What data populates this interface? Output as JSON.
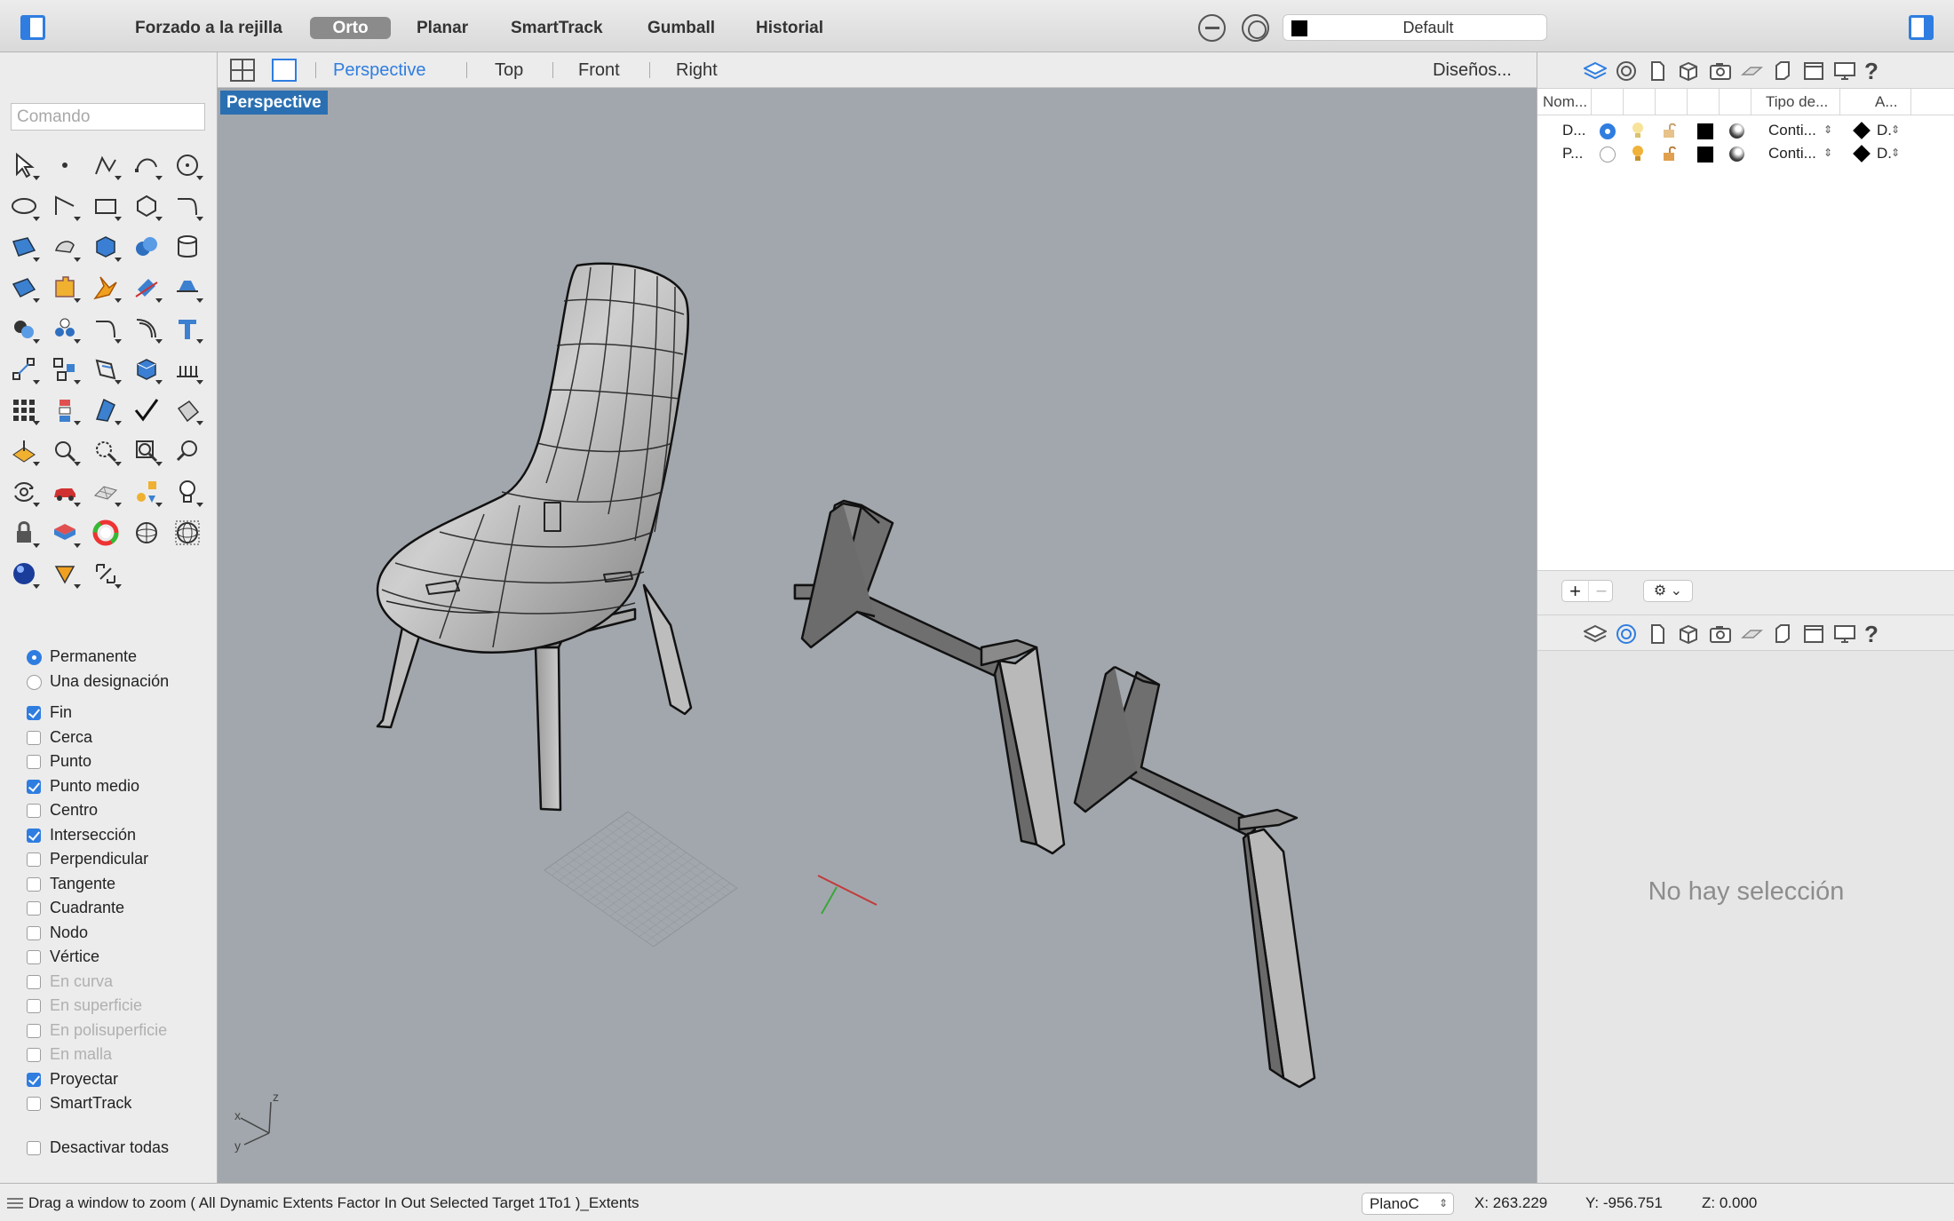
{
  "toolbar": {
    "modes": [
      {
        "label": "Forzado a la rejilla",
        "active": false
      },
      {
        "label": "Orto",
        "active": true
      },
      {
        "label": "Planar",
        "active": false
      },
      {
        "label": "SmartTrack",
        "active": false
      },
      {
        "label": "Gumball",
        "active": false
      },
      {
        "label": "Historial",
        "active": false
      }
    ],
    "current_layer": "Default",
    "current_layer_color": "#000000",
    "accent_color": "#2f7de0"
  },
  "command": {
    "placeholder": "Comando"
  },
  "tools": [
    "select-arrow-icon",
    "point-icon",
    "polyline-icon",
    "curve-icon",
    "circle-icon",
    "ellipse-icon",
    "arc-icon",
    "rectangle-icon",
    "polygon-icon",
    "fillet-curve-icon",
    "surface-from-points-icon",
    "extrude-surface-icon",
    "box-solid-icon",
    "sphere-union-icon",
    "cylinder-icon",
    "patch-surface-icon",
    "puzzle-join-icon",
    "explode-icon",
    "trim-icon",
    "split-icon",
    "boolean-icon",
    "group-icon",
    "curve-tools-icon",
    "offset-icon",
    "text-icon",
    "move-icon",
    "array-icon",
    "transform-icon",
    "box-edit-icon",
    "dimension-icon",
    "grid-array-icon",
    "align-icon",
    "extract-icon",
    "check-icon",
    "analyze-icon",
    "cplane-icon",
    "zoom-icon",
    "zoom-window-icon",
    "zoom-extents-icon",
    "zoom-selected-icon",
    "rotate-view-icon",
    "car-render-icon",
    "mesh-icon",
    "shapes-icon",
    "light-bulb-icon",
    "lock-icon",
    "layer-stack-icon",
    "color-wheel-icon",
    "sphere-shading-icon",
    "wireframe-sphere-icon",
    "render-sphere-icon",
    "named-view-icon",
    "snapshots-icon"
  ],
  "osnaps": {
    "mode": [
      {
        "label": "Permanente",
        "selected": true
      },
      {
        "label": "Una designación",
        "selected": false
      }
    ],
    "items": [
      {
        "label": "Fin",
        "checked": true,
        "enabled": true
      },
      {
        "label": "Cerca",
        "checked": false,
        "enabled": true
      },
      {
        "label": "Punto",
        "checked": false,
        "enabled": true
      },
      {
        "label": "Punto medio",
        "checked": true,
        "enabled": true
      },
      {
        "label": "Centro",
        "checked": false,
        "enabled": true
      },
      {
        "label": "Intersección",
        "checked": true,
        "enabled": true
      },
      {
        "label": "Perpendicular",
        "checked": false,
        "enabled": true
      },
      {
        "label": "Tangente",
        "checked": false,
        "enabled": true
      },
      {
        "label": "Cuadrante",
        "checked": false,
        "enabled": true
      },
      {
        "label": "Nodo",
        "checked": false,
        "enabled": true
      },
      {
        "label": "Vértice",
        "checked": false,
        "enabled": true
      },
      {
        "label": "En curva",
        "checked": false,
        "enabled": false
      },
      {
        "label": "En superficie",
        "checked": false,
        "enabled": false
      },
      {
        "label": "En polisuperficie",
        "checked": false,
        "enabled": false
      },
      {
        "label": "En malla",
        "checked": false,
        "enabled": false
      },
      {
        "label": "Proyectar",
        "checked": true,
        "enabled": true
      },
      {
        "label": "SmartTrack",
        "checked": false,
        "enabled": true
      }
    ],
    "disable_all": {
      "label": "Desactivar todas",
      "checked": false
    }
  },
  "viewport": {
    "tabs": [
      {
        "label": "Perspective",
        "active": true
      },
      {
        "label": "Top",
        "active": false
      },
      {
        "label": "Front",
        "active": false
      },
      {
        "label": "Right",
        "active": false
      }
    ],
    "layouts_label": "Diseños...",
    "active_label": "Perspective",
    "background_color": "#a2a7ad",
    "axis_labels": {
      "x": "x",
      "y": "y",
      "z": "z"
    }
  },
  "layers": {
    "columns": [
      "Nom...",
      "Tipo de...",
      "A..."
    ],
    "rows": [
      {
        "name": "D...",
        "current": true,
        "linetype": "Conti...",
        "print": "D."
      },
      {
        "name": "P...",
        "current": false,
        "linetype": "Conti...",
        "print": "D."
      }
    ]
  },
  "properties": {
    "empty_message": "No hay selección"
  },
  "status": {
    "message": "Drag a window to zoom ( All Dynamic Extents Factor In Out Selected Target 1To1 )_Extents",
    "cplane": "PlanoC",
    "x": "X: 263.229",
    "y": "Y: -956.751",
    "z": "Z: 0.000"
  }
}
